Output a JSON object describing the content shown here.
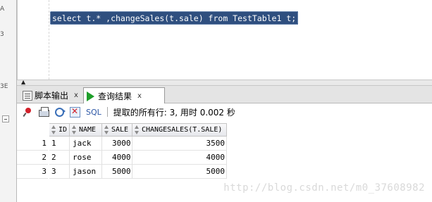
{
  "editor": {
    "sql": "select t.* ,changeSales(t.sale) from TestTable1 t;"
  },
  "left_panel": {
    "fragments": [
      "A",
      "3",
      "3E"
    ]
  },
  "tabs": [
    {
      "label": "脚本输出",
      "close": "x",
      "icon": "script-output-icon"
    },
    {
      "label": "查询结果",
      "close": "x",
      "icon": "run-query-icon"
    }
  ],
  "toolbar": {
    "sql_label": "SQL",
    "status": "提取的所有行: 3, 用时 0.002 秒"
  },
  "grid": {
    "columns": [
      "ID",
      "NAME",
      "SALE",
      "CHANGESALES(T.SALE)"
    ],
    "rows": [
      {
        "rownum": "1",
        "id": "1",
        "name": "jack",
        "sale": "3000",
        "changesales": "3500"
      },
      {
        "rownum": "2",
        "id": "2",
        "name": "rose",
        "sale": "4000",
        "changesales": "4000"
      },
      {
        "rownum": "3",
        "id": "3",
        "name": "jason",
        "sale": "5000",
        "changesales": "5000"
      }
    ]
  },
  "watermark": "http://blog.csdn.net/m0_37608982"
}
